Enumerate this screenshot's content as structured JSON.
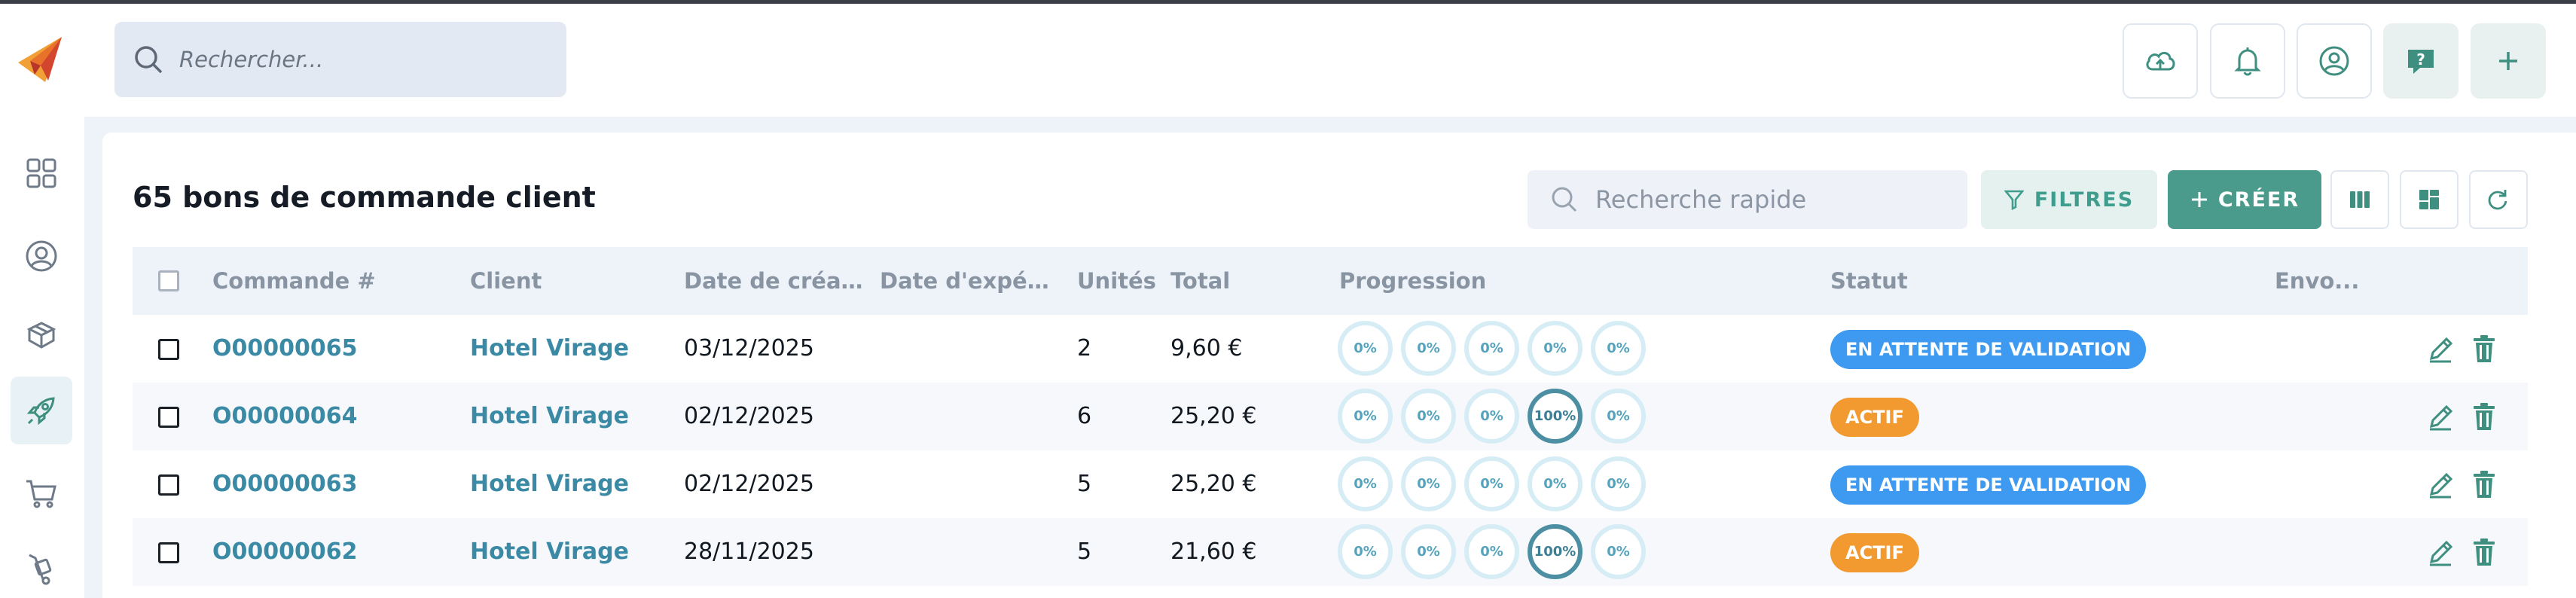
{
  "topbar": {
    "search_placeholder": "Rechercher...",
    "buttons": [
      "cloud-upload-icon",
      "bell-icon",
      "user-circle-icon",
      "help-icon",
      "plus-icon"
    ]
  },
  "sidebar": {
    "items": [
      {
        "icon": "dashboard-icon",
        "active": false
      },
      {
        "icon": "user-icon",
        "active": false
      },
      {
        "icon": "box-icon",
        "active": false
      },
      {
        "icon": "rocket-icon",
        "active": true
      },
      {
        "icon": "cart-icon",
        "active": false
      },
      {
        "icon": "hand-truck-icon",
        "active": false
      }
    ]
  },
  "main": {
    "title": "65 bons de commande client",
    "quick_search_placeholder": "Recherche rapide",
    "filter_label": "FILTRES",
    "create_label": "CRÉER"
  },
  "table": {
    "columns": {
      "order": "Commande #",
      "client": "Client",
      "created": "Date de créati...",
      "shipped": "Date d'expédit...",
      "units": "Unités",
      "total": "Total",
      "progress": "Progression",
      "status": "Statut",
      "sent": "Envo..."
    },
    "rows": [
      {
        "order": "O00000065",
        "client": "Hotel Virage",
        "created": "03/12/2025",
        "shipped": "",
        "units": "2",
        "total": "9,60 €",
        "progress": [
          "0%",
          "0%",
          "0%",
          "0%",
          "0%"
        ],
        "status": "EN ATTENTE DE VALIDATION",
        "status_color": "#3d9af0"
      },
      {
        "order": "O00000064",
        "client": "Hotel Virage",
        "created": "02/12/2025",
        "shipped": "",
        "units": "6",
        "total": "25,20 €",
        "progress": [
          "0%",
          "0%",
          "0%",
          "100%",
          "0%"
        ],
        "status": "ACTIF",
        "status_color": "#f29a30"
      },
      {
        "order": "O00000063",
        "client": "Hotel Virage",
        "created": "02/12/2025",
        "shipped": "",
        "units": "5",
        "total": "25,20 €",
        "progress": [
          "0%",
          "0%",
          "0%",
          "0%",
          "0%"
        ],
        "status": "EN ATTENTE DE VALIDATION",
        "status_color": "#3d9af0"
      },
      {
        "order": "O00000062",
        "client": "Hotel Virage",
        "created": "28/11/2025",
        "shipped": "",
        "units": "5",
        "total": "21,60 €",
        "progress": [
          "0%",
          "0%",
          "0%",
          "100%",
          "0%"
        ],
        "status": "ACTIF",
        "status_color": "#f29a30"
      }
    ]
  },
  "colors": {
    "accent": "#4a9b8c",
    "link": "#3b8aa5",
    "status_pending": "#3d9af0",
    "status_active": "#f29a30"
  }
}
